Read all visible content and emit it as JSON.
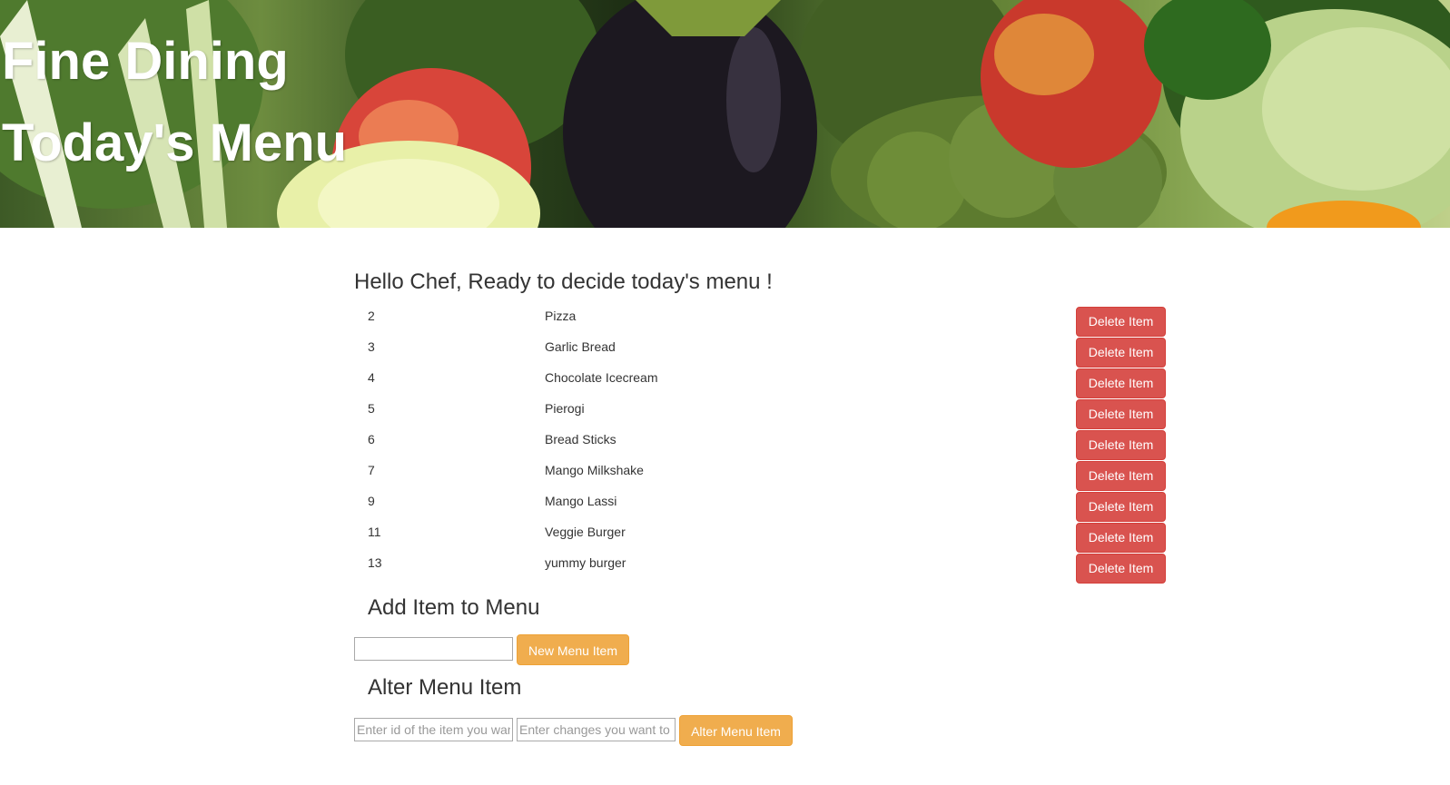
{
  "hero": {
    "title_line1": "Fine Dining",
    "title_line2": "Today's Menu"
  },
  "greeting": "Hello Chef, Ready to decide today's menu !",
  "menu": {
    "delete_label": "Delete Item",
    "items": [
      {
        "id": "2",
        "name": "Pizza"
      },
      {
        "id": "3",
        "name": "Garlic Bread"
      },
      {
        "id": "4",
        "name": "Chocolate Icecream"
      },
      {
        "id": "5",
        "name": "Pierogi"
      },
      {
        "id": "6",
        "name": "Bread Sticks"
      },
      {
        "id": "7",
        "name": "Mango Milkshake"
      },
      {
        "id": "9",
        "name": "Mango Lassi"
      },
      {
        "id": "11",
        "name": "Veggie Burger"
      },
      {
        "id": "13",
        "name": "yummy burger"
      }
    ]
  },
  "add_section": {
    "title": "Add Item to Menu",
    "input_value": "",
    "button_label": "New Menu Item"
  },
  "alter_section": {
    "title": "Alter Menu Item",
    "id_placeholder": "Enter id of the item you want to alter",
    "changes_placeholder": "Enter changes you want to make",
    "button_label": "Alter Menu Item"
  },
  "colors": {
    "danger": "#d9534f",
    "warning": "#f0ad4e",
    "text": "#333333"
  }
}
